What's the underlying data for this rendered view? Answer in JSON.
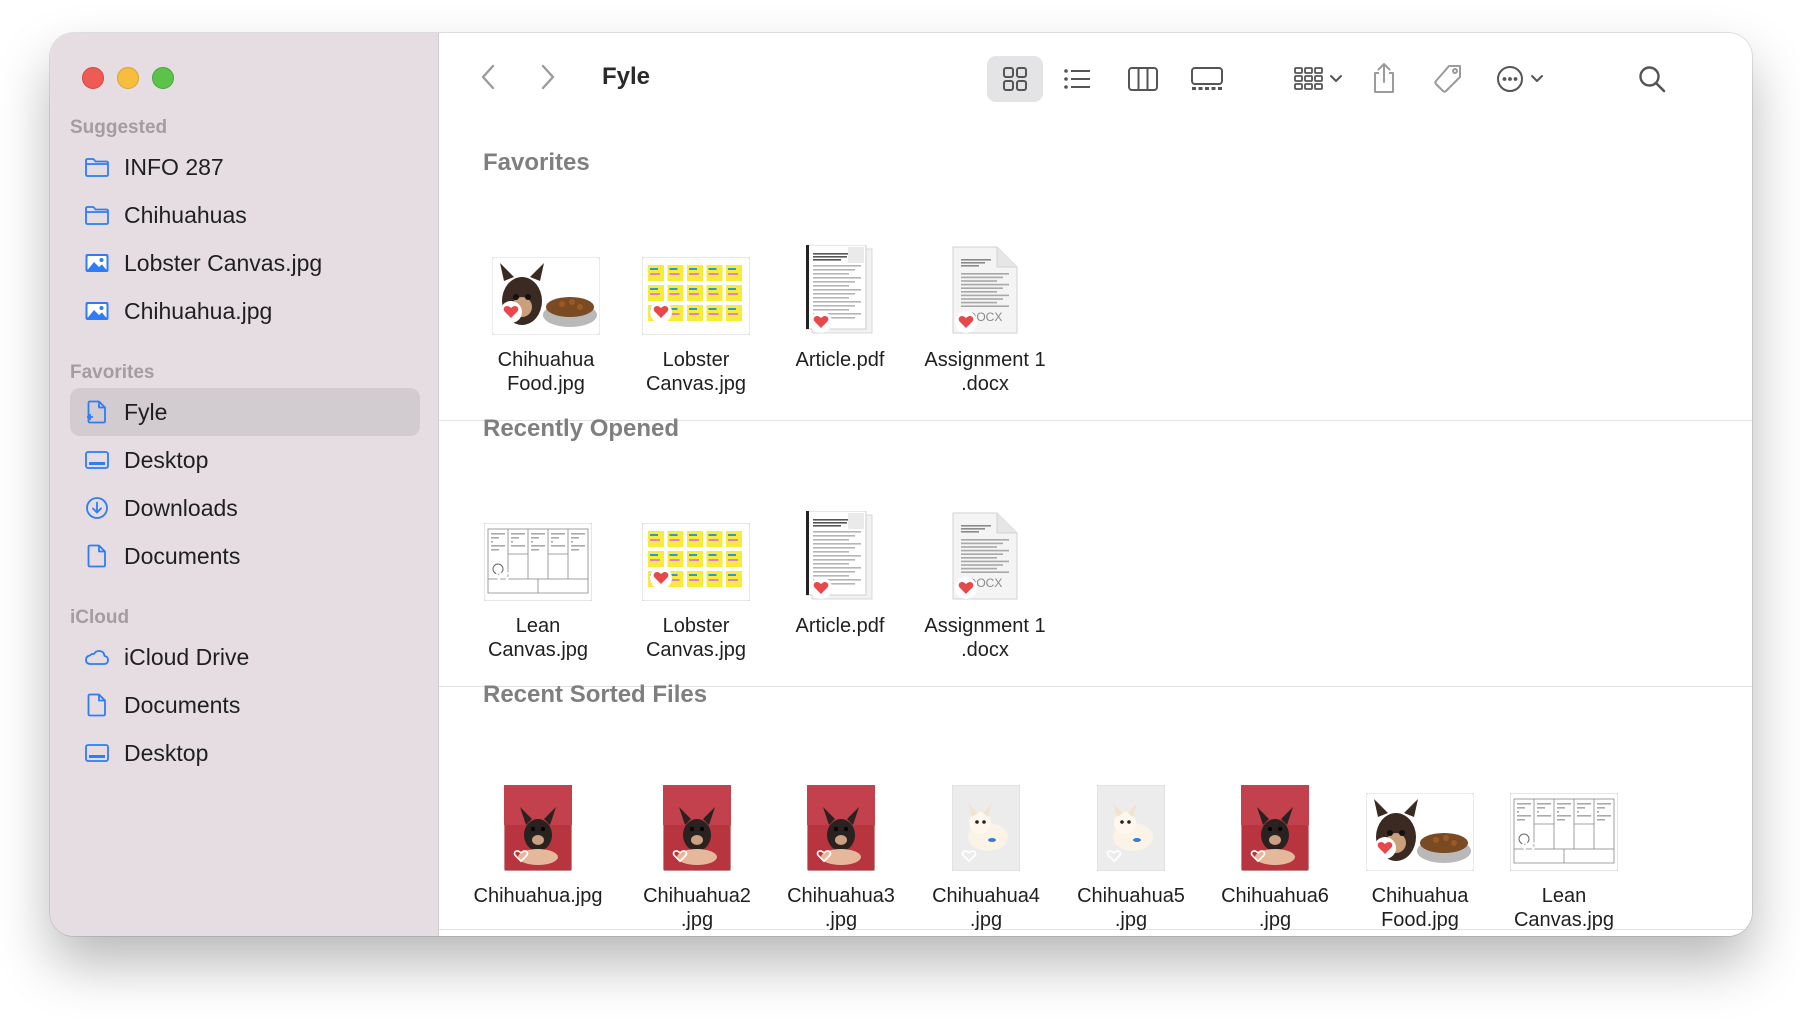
{
  "window": {
    "title": "Fyle"
  },
  "colors": {
    "close": "#ee5a54",
    "minimize": "#f6bd3e",
    "zoom": "#5cc34a",
    "accent": "#2e7cf6",
    "sidebar_bg": "#e5dde2",
    "heart": "#e8484a"
  },
  "sidebar": {
    "sections": [
      {
        "title": "Suggested",
        "items": [
          {
            "label": "INFO 287",
            "icon": "folder-icon"
          },
          {
            "label": "Chihuahuas",
            "icon": "folder-icon"
          },
          {
            "label": "Lobster Canvas.jpg",
            "icon": "image-icon"
          },
          {
            "label": "Chihuahua.jpg",
            "icon": "image-icon"
          }
        ]
      },
      {
        "title": "Favorites",
        "items": [
          {
            "label": "Fyle",
            "icon": "document-icon",
            "active": true
          },
          {
            "label": "Desktop",
            "icon": "desktop-icon"
          },
          {
            "label": "Downloads",
            "icon": "download-icon"
          },
          {
            "label": "Documents",
            "icon": "document-icon"
          }
        ]
      },
      {
        "title": "iCloud",
        "items": [
          {
            "label": "iCloud Drive",
            "icon": "cloud-icon"
          },
          {
            "label": "Documents",
            "icon": "document-icon"
          },
          {
            "label": "Desktop",
            "icon": "desktop-icon"
          }
        ]
      }
    ]
  },
  "toolbar": {
    "back": "chevron-left-icon",
    "forward": "chevron-right-icon",
    "views": [
      "icon-view-icon",
      "list-view-icon",
      "column-view-icon",
      "gallery-view-icon"
    ],
    "group": "group-icon",
    "share": "share-icon",
    "tags": "tag-icon",
    "more": "more-icon",
    "search": "search-icon"
  },
  "sections": [
    {
      "title": "Favorites",
      "files": [
        {
          "name": "Chihuahua\nFood.jpg",
          "kind": "dog-food"
        },
        {
          "name": "Lobster\nCanvas.jpg",
          "kind": "lobster"
        },
        {
          "name": "Article.pdf",
          "kind": "pdf"
        },
        {
          "name": "Assignment 1\n.docx",
          "kind": "docx"
        }
      ]
    },
    {
      "title": "Recently Opened",
      "files": [
        {
          "name": "Lean\nCanvas.jpg",
          "kind": "lean"
        },
        {
          "name": "Lobster\nCanvas.jpg",
          "kind": "lobster"
        },
        {
          "name": "Article.pdf",
          "kind": "pdf"
        },
        {
          "name": "Assignment 1\n.docx",
          "kind": "docx"
        }
      ]
    },
    {
      "title": "Recent Sorted Files",
      "files": [
        {
          "name": "Chihuahua.jpg",
          "kind": "red-dog"
        },
        {
          "name": "Chihuahua2\n.jpg",
          "kind": "red-dog"
        },
        {
          "name": "Chihuahua3\n.jpg",
          "kind": "red-dog"
        },
        {
          "name": "Chihuahua4\n.jpg",
          "kind": "white-dog"
        },
        {
          "name": "Chihuahua5\n.jpg",
          "kind": "white-dog"
        },
        {
          "name": "Chihuahua6\n.jpg",
          "kind": "red-dog"
        },
        {
          "name": "Chihuahua\nFood.jpg",
          "kind": "dog-food"
        },
        {
          "name": "Lean\nCanvas.jpg",
          "kind": "lean"
        }
      ]
    }
  ]
}
